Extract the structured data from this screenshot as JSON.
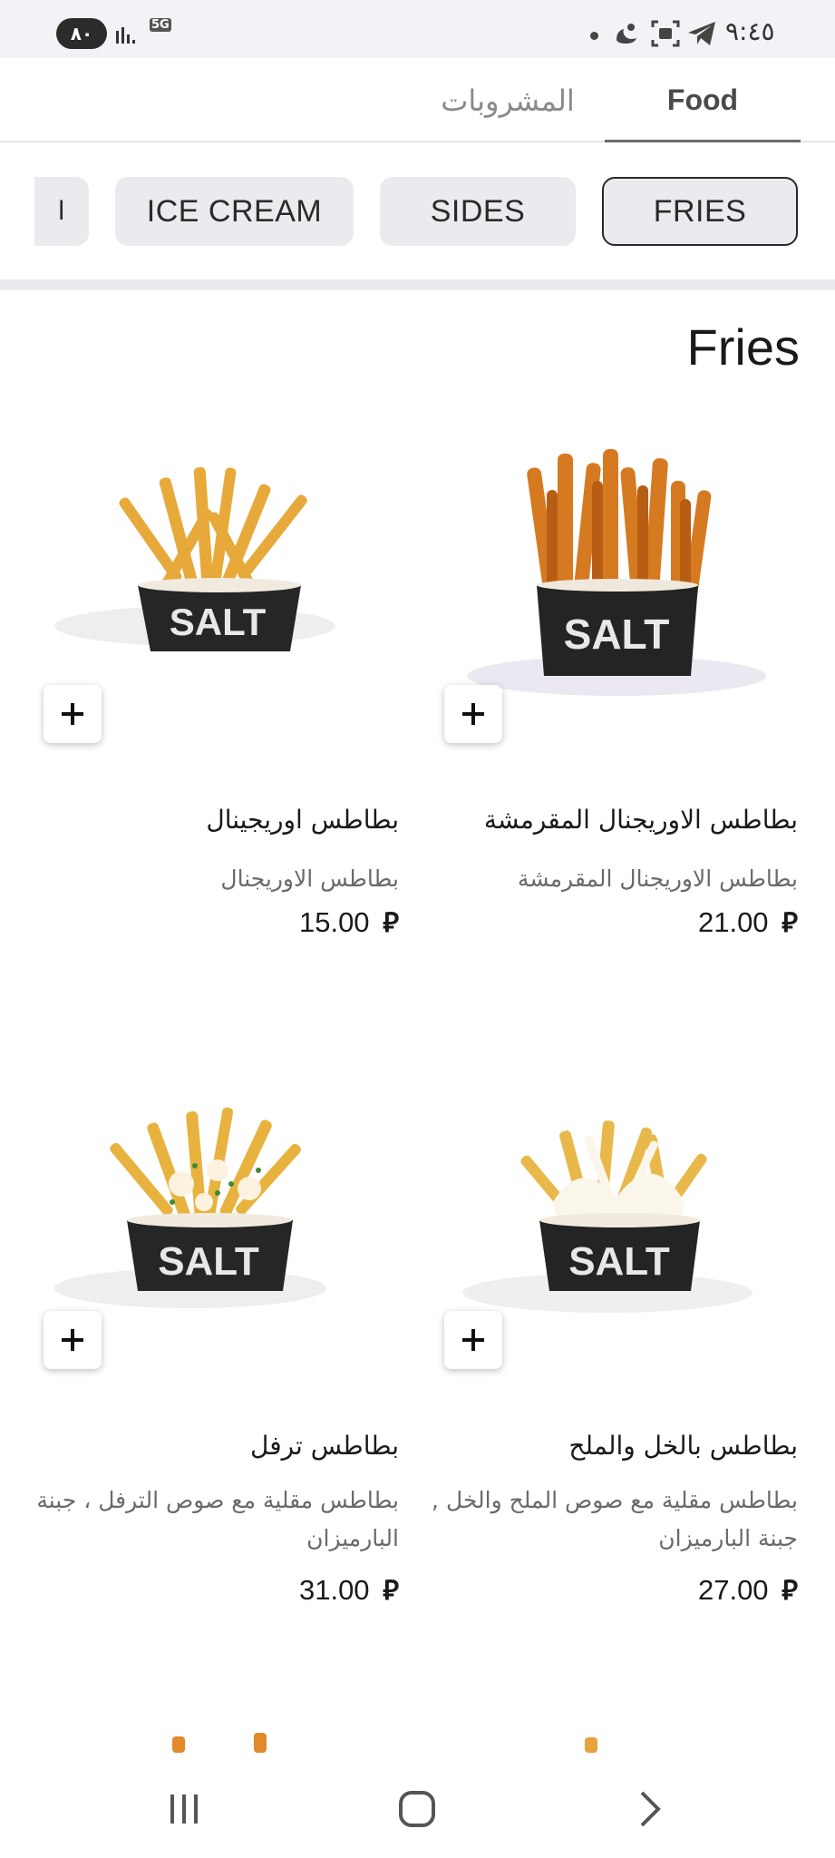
{
  "status_bar": {
    "battery": "٨٠",
    "network": "5G",
    "time": "٩:٤٥",
    "icons": [
      "signal-icon",
      "network-5g-icon",
      "dot-icon",
      "moon-icon",
      "screen-capture-icon",
      "telegram-icon"
    ]
  },
  "tabs": [
    {
      "label": "Food",
      "active": true
    },
    {
      "label": "المشروبات",
      "active": false
    }
  ],
  "categories": [
    {
      "label": "FRIES",
      "active": true
    },
    {
      "label": "SIDES",
      "active": false
    },
    {
      "label": "ICE CREAM",
      "active": false
    }
  ],
  "section_title": "Fries",
  "currency_symbol": "⃁",
  "products": [
    {
      "title": "بطاطس الاوريجنال المقرمشة",
      "description": "بطاطس الاوريجنال المقرمشة",
      "price": "21.00"
    },
    {
      "title": "بطاطس اوريجينال",
      "description": "بطاطس الاوريجنال",
      "price": "15.00"
    },
    {
      "title": "بطاطس بالخل والملح",
      "description": "بطاطس مقلية مع صوص الملح والخل , جبنة البارميزان",
      "price": "27.00"
    },
    {
      "title": "بطاطس ترفل",
      "description": "بطاطس مقلية مع صوص الترفل ، جبنة البارميزان",
      "price": "31.00"
    }
  ],
  "colors": {
    "accent": "#6b6b6b",
    "chip_bg": "#ebebef",
    "status_bg": "#f2f2f7"
  }
}
